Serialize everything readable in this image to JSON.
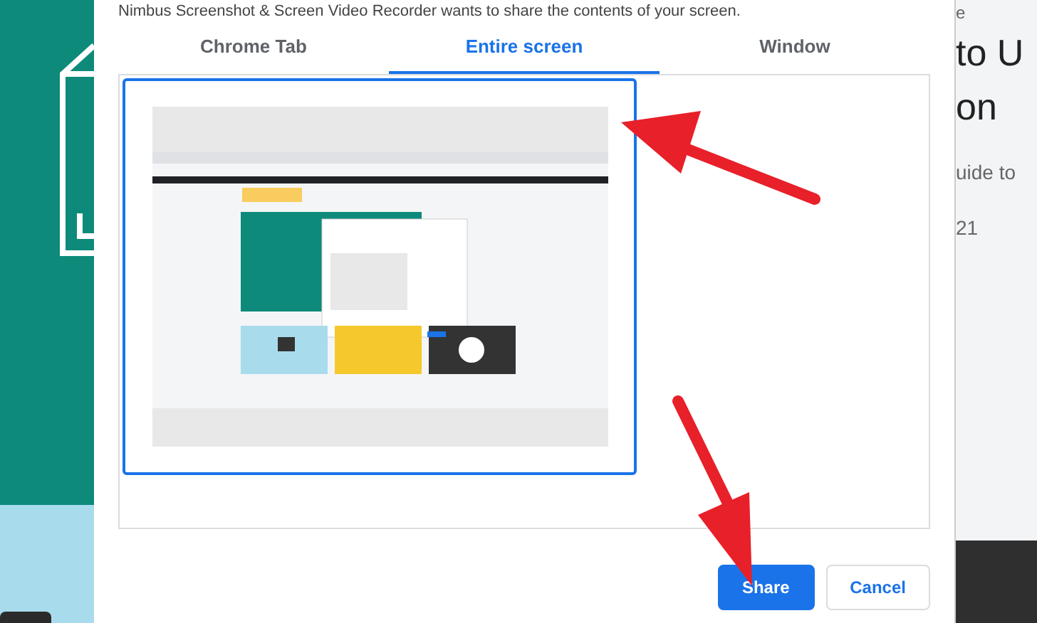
{
  "dialog": {
    "message": "Nimbus Screenshot & Screen Video Recorder wants to share the contents of your screen.",
    "tabs": [
      {
        "label": "Chrome Tab",
        "selected": false
      },
      {
        "label": "Entire screen",
        "selected": true
      },
      {
        "label": "Window",
        "selected": false
      }
    ],
    "sources": [
      {
        "kind": "picture",
        "selected": true
      }
    ],
    "buttons": [
      {
        "label": "Share",
        "kind": "primary"
      },
      {
        "label": "Cancel",
        "kind": "secondary"
      }
    ]
  },
  "background_page": {
    "texts": [
      {
        "text": "e",
        "kind": "small"
      },
      {
        "text": "to U",
        "kind": "heading"
      },
      {
        "text": "on",
        "kind": "heading"
      },
      {
        "text": "uide to",
        "kind": "body"
      },
      {
        "text": "21",
        "kind": "body"
      }
    ]
  }
}
